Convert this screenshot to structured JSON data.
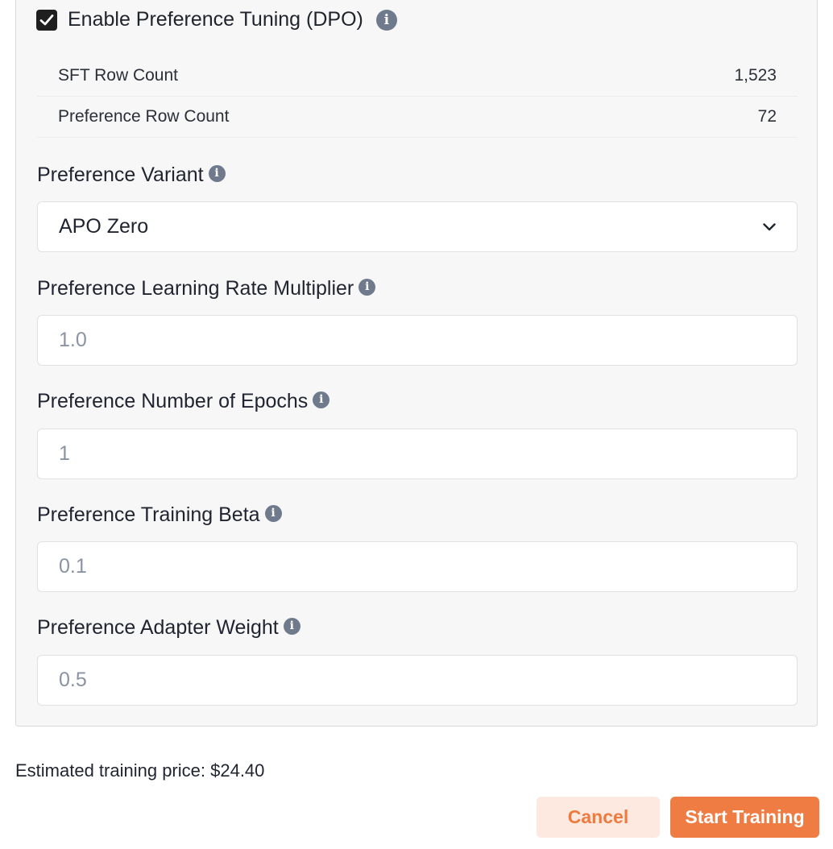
{
  "dpo": {
    "enabled": true,
    "label": "Enable Preference Tuning (DPO)",
    "info_icon": "i"
  },
  "stats": [
    {
      "label": "SFT Row Count",
      "value": "1,523"
    },
    {
      "label": "Preference Row Count",
      "value": "72"
    }
  ],
  "fields": {
    "variant": {
      "label": "Preference Variant",
      "value": "APO Zero"
    },
    "learning_rate": {
      "label": "Preference Learning Rate Multiplier",
      "placeholder": "1.0"
    },
    "epochs": {
      "label": "Preference Number of Epochs",
      "placeholder": "1"
    },
    "beta": {
      "label": "Preference Training Beta",
      "placeholder": "0.1"
    },
    "adapter_weight": {
      "label": "Preference Adapter Weight",
      "placeholder": "0.5"
    }
  },
  "info_glyph": "i",
  "estimate": "Estimated training price: $24.40",
  "buttons": {
    "cancel": "Cancel",
    "start": "Start Training"
  },
  "colors": {
    "accent": "#ef7d43",
    "accent_light": "#fde9e0",
    "info_icon": "#6f7b8d",
    "panel_bg": "#f7f7f7"
  }
}
